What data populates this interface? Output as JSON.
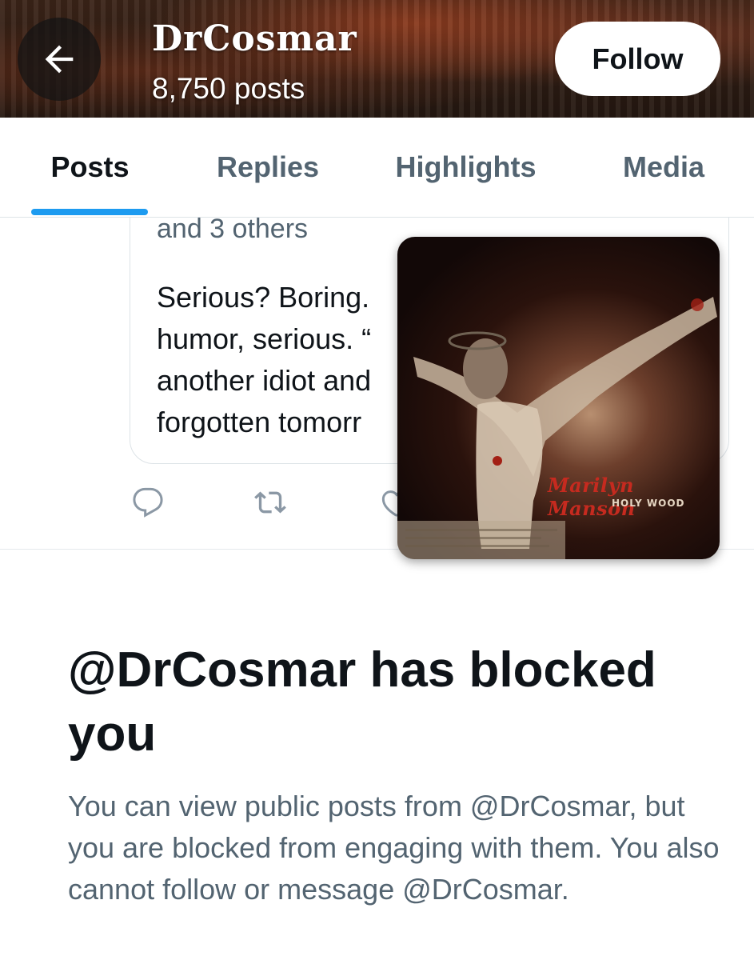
{
  "header": {
    "profile_name": "DrCosmar",
    "post_count": "8,750 posts",
    "follow_label": "Follow",
    "back_icon": "arrow-left-icon"
  },
  "tabs": [
    {
      "label": "Posts",
      "active": true
    },
    {
      "label": "Replies",
      "active": false
    },
    {
      "label": "Highlights",
      "active": false
    },
    {
      "label": "Media",
      "active": false
    }
  ],
  "quoted_post": {
    "others_line": "and 3 others",
    "body_lines": [
      "Serious?  Boring.",
      "humor, serious. “",
      "another idiot and",
      "forgotten tomorr"
    ]
  },
  "actions": {
    "reply_icon": "reply-icon",
    "retweet_icon": "retweet-icon",
    "like_icon": "heart-icon"
  },
  "album": {
    "artist": "Marilyn Manson",
    "title": "HOLY WOOD"
  },
  "blocked": {
    "title": "@DrCosmar has blocked you",
    "description": "You can view public posts from @DrCosmar, but you are blocked from engaging with them. You also cannot follow or message @DrCosmar."
  },
  "colors": {
    "accent": "#1d9bf0",
    "text_primary": "#0f1419",
    "text_secondary": "#536471",
    "album_title_red": "#c62a1f"
  }
}
